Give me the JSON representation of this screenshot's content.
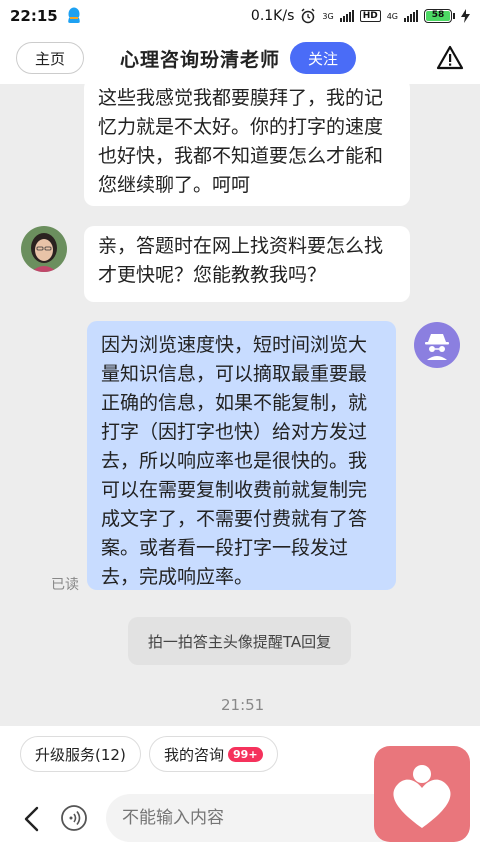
{
  "status_bar": {
    "time": "22:15",
    "speed": "0.1K/s",
    "net1": "3G",
    "hd": "HD",
    "net2": "4G",
    "battery": "58"
  },
  "header": {
    "home_label": "主页",
    "title": "心理咨询玢清老师",
    "follow_label": "关注"
  },
  "messages": {
    "m1": "这些我感觉我都要膜拜了，我的记忆力就是不太好。你的打字的速度也好快，我都不知道要怎么才能和您继续聊了。呵呵",
    "m2": "亲，答题时在网上找资料要怎么找才更快呢？您能教教我吗？",
    "m3": "因为浏览速度快，短时间浏览大量知识信息，可以摘取最重要最正确的信息，如果不能复制，就打字（因打字也快）给对方发过去，所以响应率也是很快的。我可以在需要复制收费前就复制完成文字了，不需要付费就有了答案。或者看一段打字一段发过去，完成响应率。",
    "read_label": "已读",
    "hint": "拍一拍答主头像提醒TA回复",
    "timestamp": "21:51"
  },
  "chips": {
    "upgrade": "升级服务(12)",
    "consult": "我的咨询",
    "consult_badge": "99+"
  },
  "input": {
    "placeholder": "不能输入内容"
  },
  "colors": {
    "accent": "#4a6cf7",
    "bubble_right": "#c8dcff",
    "badge": "#f5325c",
    "heart_app": "#e9767c"
  }
}
